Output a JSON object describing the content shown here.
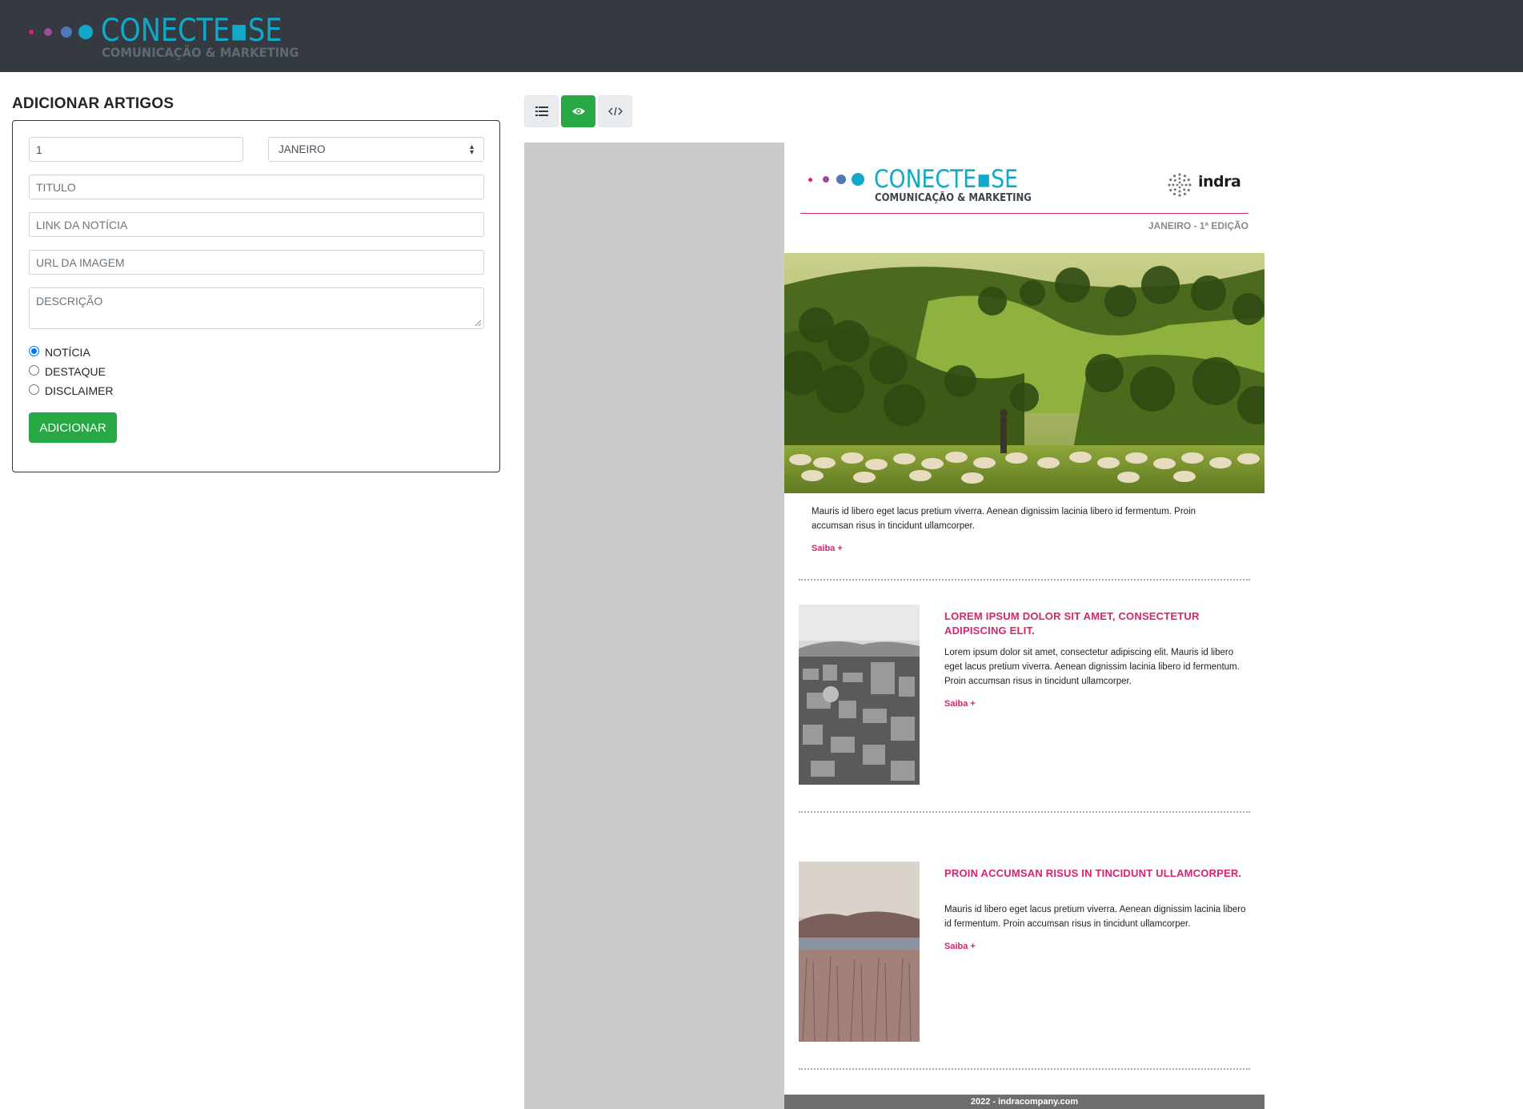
{
  "brand": {
    "title": "CONECTE▪SE",
    "subtitle": "COMUNICAÇÃO & MARKETING",
    "dot_colors": [
      "#d6246e",
      "#9b4b9a",
      "#4f79b6",
      "#12a8c9"
    ]
  },
  "form": {
    "heading": "ADICIONAR ARTIGOS",
    "number_value": "1",
    "month_value": "JANEIRO",
    "title_placeholder": "TITULO",
    "link_placeholder": "LINK DA NOTÍCIA",
    "image_url_placeholder": "URL DA IMAGEM",
    "description_placeholder": "DESCRIÇÃO",
    "types": [
      {
        "label": "NOTÍCIA",
        "checked": true
      },
      {
        "label": "DESTAQUE",
        "checked": false
      },
      {
        "label": "DISCLAIMER",
        "checked": false
      }
    ],
    "submit_label": "ADICIONAR"
  },
  "toolbar": {
    "buttons": [
      {
        "icon": "list-icon",
        "active": false
      },
      {
        "icon": "eye-icon",
        "active": true
      },
      {
        "icon": "code-icon",
        "active": false
      }
    ]
  },
  "email": {
    "brand_title": "CONECTE▪SE",
    "brand_subtitle": "COMUNICAÇÃO & MARKETING",
    "partner": "indra",
    "edition": "JANEIRO - 1ª EDIÇÃO",
    "accent_color": "#d6246e",
    "hero": {
      "text": "Mauris id libero eget lacus pretium viverra. Aenean dignissim lacinia libero id fermentum. Proin accumsan risus in tincidunt ullamcorper.",
      "link": "Saiba +"
    },
    "articles": [
      {
        "title": "LOREM IPSUM DOLOR SIT AMET, CONSECTETUR ADIPISCING ELIT.",
        "text": "Lorem ipsum dolor sit amet, consectetur adipiscing elit. Mauris id libero eget lacus pretium viverra. Aenean dignissim lacinia libero id fermentum. Proin accumsan risus in tincidunt ullamcorper.",
        "link": "Saiba +"
      },
      {
        "title": "PROIN ACCUMSAN RISUS IN TINCIDUNT ULLAMCORPER.",
        "text": "Mauris id libero eget lacus pretium viverra. Aenean dignissim lacinia libero id fermentum. Proin accumsan risus in tincidunt ullamcorper.",
        "link": "Saiba +"
      }
    ],
    "footer": "2022 - indracompany.com"
  }
}
